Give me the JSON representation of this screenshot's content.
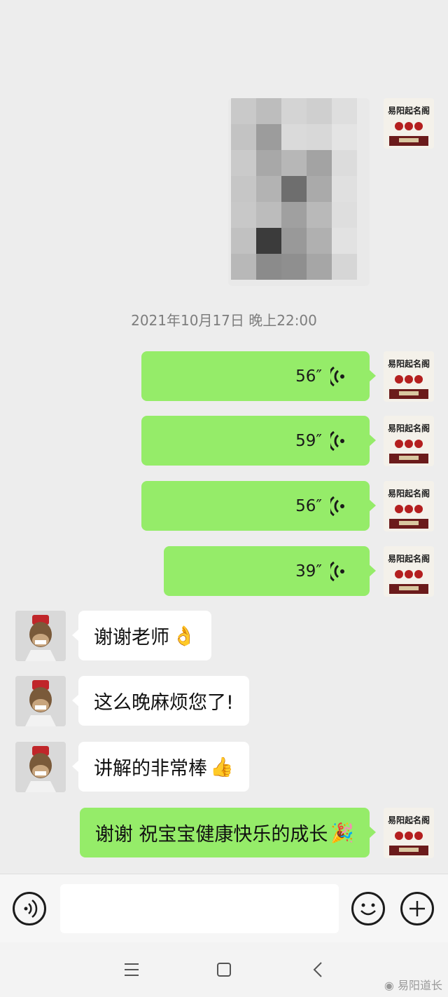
{
  "timestamp": "2021年10月17日 晚上22:00",
  "my_avatar_text": "易阳起名阁",
  "voice_messages": [
    {
      "duration": "56″"
    },
    {
      "duration": "59″"
    },
    {
      "duration": "56″"
    },
    {
      "duration": "39″"
    }
  ],
  "incoming_messages": [
    {
      "text": "谢谢老师",
      "emoji": "👌"
    },
    {
      "text": "这么晚麻烦您了!",
      "emoji": ""
    },
    {
      "text": "讲解的非常棒",
      "emoji": "👍"
    }
  ],
  "outgoing_text": {
    "text": "谢谢 祝宝宝健康快乐的成长",
    "emoji": "🎉"
  },
  "input": {
    "placeholder": ""
  },
  "watermark": "易阳道长",
  "colors": {
    "my_bubble": "#95ec69",
    "their_bubble": "#ffffff",
    "background": "#ededed"
  }
}
